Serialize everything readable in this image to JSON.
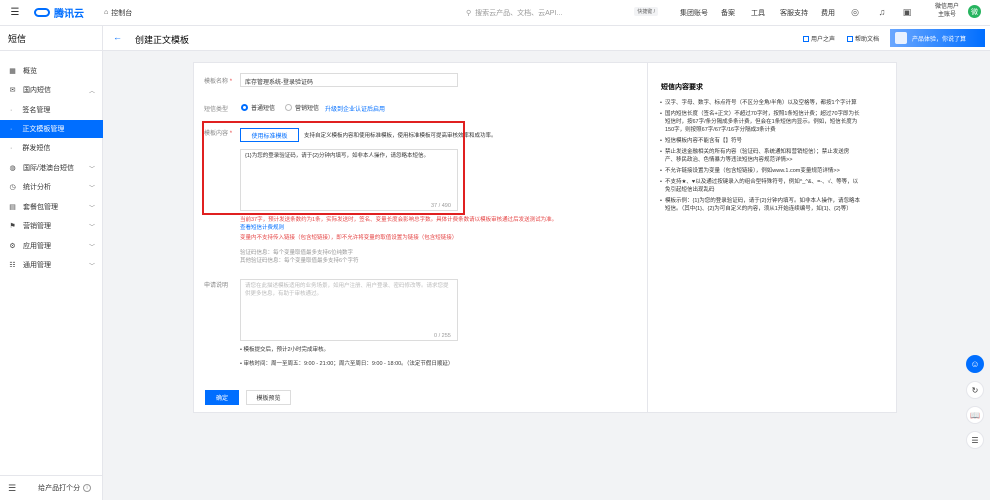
{
  "topbar": {
    "logo_text": "腾讯云",
    "console_label": "控制台",
    "search_placeholder": "搜索云产品、文档、云API...",
    "search_shortcut": "快捷键 /",
    "nav_items": [
      "集团账号",
      "备案",
      "工具",
      "客服支持",
      "费用"
    ],
    "user_name": "微信用户",
    "user_role": "主账号",
    "avatar_letter": "微"
  },
  "sidebar": {
    "title": "短信",
    "items": [
      {
        "label": "概览",
        "icon": "grid-icon"
      },
      {
        "label": "国内短信",
        "icon": "mail-icon",
        "expanded": true
      },
      {
        "label": "签名管理",
        "sub": true
      },
      {
        "label": "正文模板管理",
        "sub": true,
        "active": true
      },
      {
        "label": "群发短信",
        "sub": true
      },
      {
        "label": "国际/港澳台短信",
        "icon": "globe-icon"
      },
      {
        "label": "统计分析",
        "icon": "clock-icon"
      },
      {
        "label": "套餐包管理",
        "icon": "package-icon"
      },
      {
        "label": "营销管理",
        "icon": "marketing-icon"
      },
      {
        "label": "应用管理",
        "icon": "gear-icon"
      },
      {
        "label": "通用管理",
        "icon": "list-icon"
      }
    ],
    "feedback_label": "给产品打个分"
  },
  "page": {
    "title": "创建正文模板",
    "user_voice": "用户之声",
    "help_doc": "帮助文档",
    "promo": "产品体验，你说了算"
  },
  "form": {
    "name_label": "模板名称",
    "name_value": "库存管理系统-登录验证码",
    "type_label": "短信类型",
    "type_options": [
      "普通短信",
      "营销短信"
    ],
    "upgrade_link": "升级到企业认证后启用",
    "content_label": "模板内容",
    "use_standard_btn": "使用标准模板",
    "standard_hint": "支持自定义模板内容和使用标准模板，使用标准模板可提高审核效率和成功率。",
    "content_value": "{1}为您的登录验证码，请于{2}分钟内填写，如非本人操作，请忽略本短信。",
    "content_counter": "37 / 490",
    "warn_line1": "当前37字，预计发送条数约为1条，实际发送时，签名、变量长度会影响总字数。具体计费条数请以模板审核通过后发送测试为准。",
    "warn_link": "查看短信计费规则",
    "warn_line2": "变量内不支持传入链接（包含短链接），即不允许将变量的取值设置为链接（包含短链接）",
    "var_note1": "验证码信息：每个变量取值最多支持6位纯数字",
    "var_note2": "其他验证码信息：每个变量取值最多支持6个字符",
    "apply_label": "申请说明",
    "apply_placeholder": "请您在此描述模板适用的业务场景，如用户注册、用户登录、密码修改等。请求您提供更多信息，有助于审核通过。",
    "apply_counter": "0 / 255",
    "bullet1": "模板提交后，预计2小时完成审核。",
    "bullet2": "审核时间：周一至周五：9:00 - 21:00；周六至周日：9:00 - 18:00。（法定节假日顺延）",
    "submit_btn": "确定",
    "preview_btn": "模板预览"
  },
  "requirements": {
    "title": "短信内容要求",
    "items": [
      "汉字、字母、数字、标点符号（不区分全角/半角）以及空格等，都按1个字计算",
      "国内短信长度（签名+正文）不超过70字时，按照1条短信计费；超过70字即为长短信时，按67字/条分隔成多条计费，但会在1条短信内显示。例如，短信长度为150字，则按照67字/67字/16字分隔成3条计费",
      "短信模板内容不能含有【】符号",
      "禁止发送金融相关的所有内容（验证码、系统通知和营销短信）；禁止发送房产、移民政治、色情暴力等违法短信内容规范详情>>",
      "不允许链接设置为变量（包含短链接），例如www.1.com变量规范详情>>",
      "不支持★、♥以及通过按键录入的组合型特殊符号，例如^_^&、=-、√、等等，以免引起短信出现乱码",
      "模板示例：{1}为您的登录验证码，请于{2}分钟内填写。如非本人操作，请忽略本短信。（其中{1}、{2}为可自定义的内容，须从1开始连续编号，如{1}、{2}等）"
    ]
  },
  "colors": {
    "accent": "#006eff",
    "highlight_border": "#e02020",
    "warning_text": "#e54545"
  }
}
